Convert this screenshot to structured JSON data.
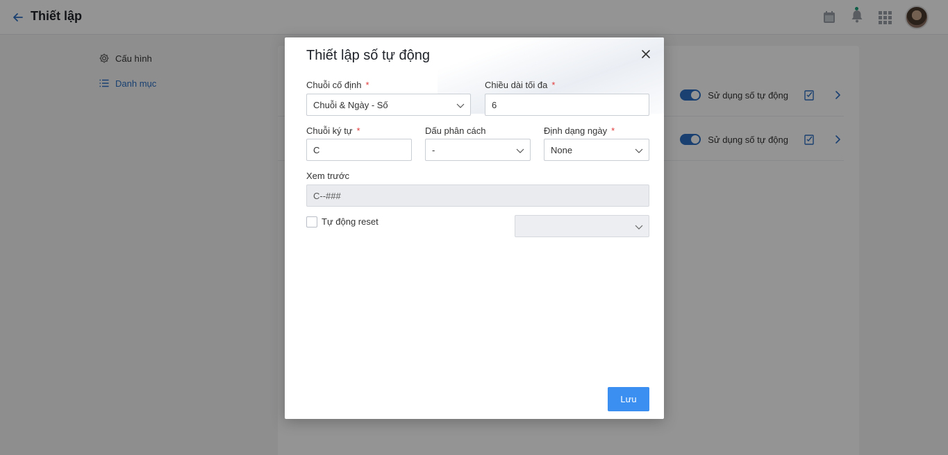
{
  "header": {
    "title": "Thiết lập"
  },
  "sidebar": {
    "items": [
      {
        "label": "Cấu hình"
      },
      {
        "label": "Danh mục"
      }
    ]
  },
  "content": {
    "rows": [
      {
        "toggle_label": "Sử dụng số tự động",
        "toggle_on": true
      },
      {
        "toggle_label": "Sử dụng số tự động",
        "toggle_on": true
      }
    ]
  },
  "modal": {
    "title": "Thiết lập số tự động",
    "fixed_string": {
      "label": "Chuỗi cố định",
      "required_mark": "*",
      "value": "Chuỗi & Ngày - Số"
    },
    "max_length": {
      "label": "Chiều dài tối đa",
      "required_mark": "*",
      "value": "6"
    },
    "char_string": {
      "label": "Chuỗi ký tự",
      "required_mark": "*",
      "value": "C"
    },
    "separator": {
      "label": "Dấu phân cách",
      "value": "-"
    },
    "date_format": {
      "label": "Định dạng ngày",
      "required_mark": "*",
      "value": "None"
    },
    "preview": {
      "label": "Xem trước",
      "value": "C--###"
    },
    "auto_reset": {
      "label": "Tự động reset",
      "checked": false,
      "select_value": ""
    },
    "save_label": "Lưu"
  },
  "colors": {
    "accent": "#2b6fc2",
    "button": "#3a8ff0",
    "required": "#e23b3b"
  }
}
